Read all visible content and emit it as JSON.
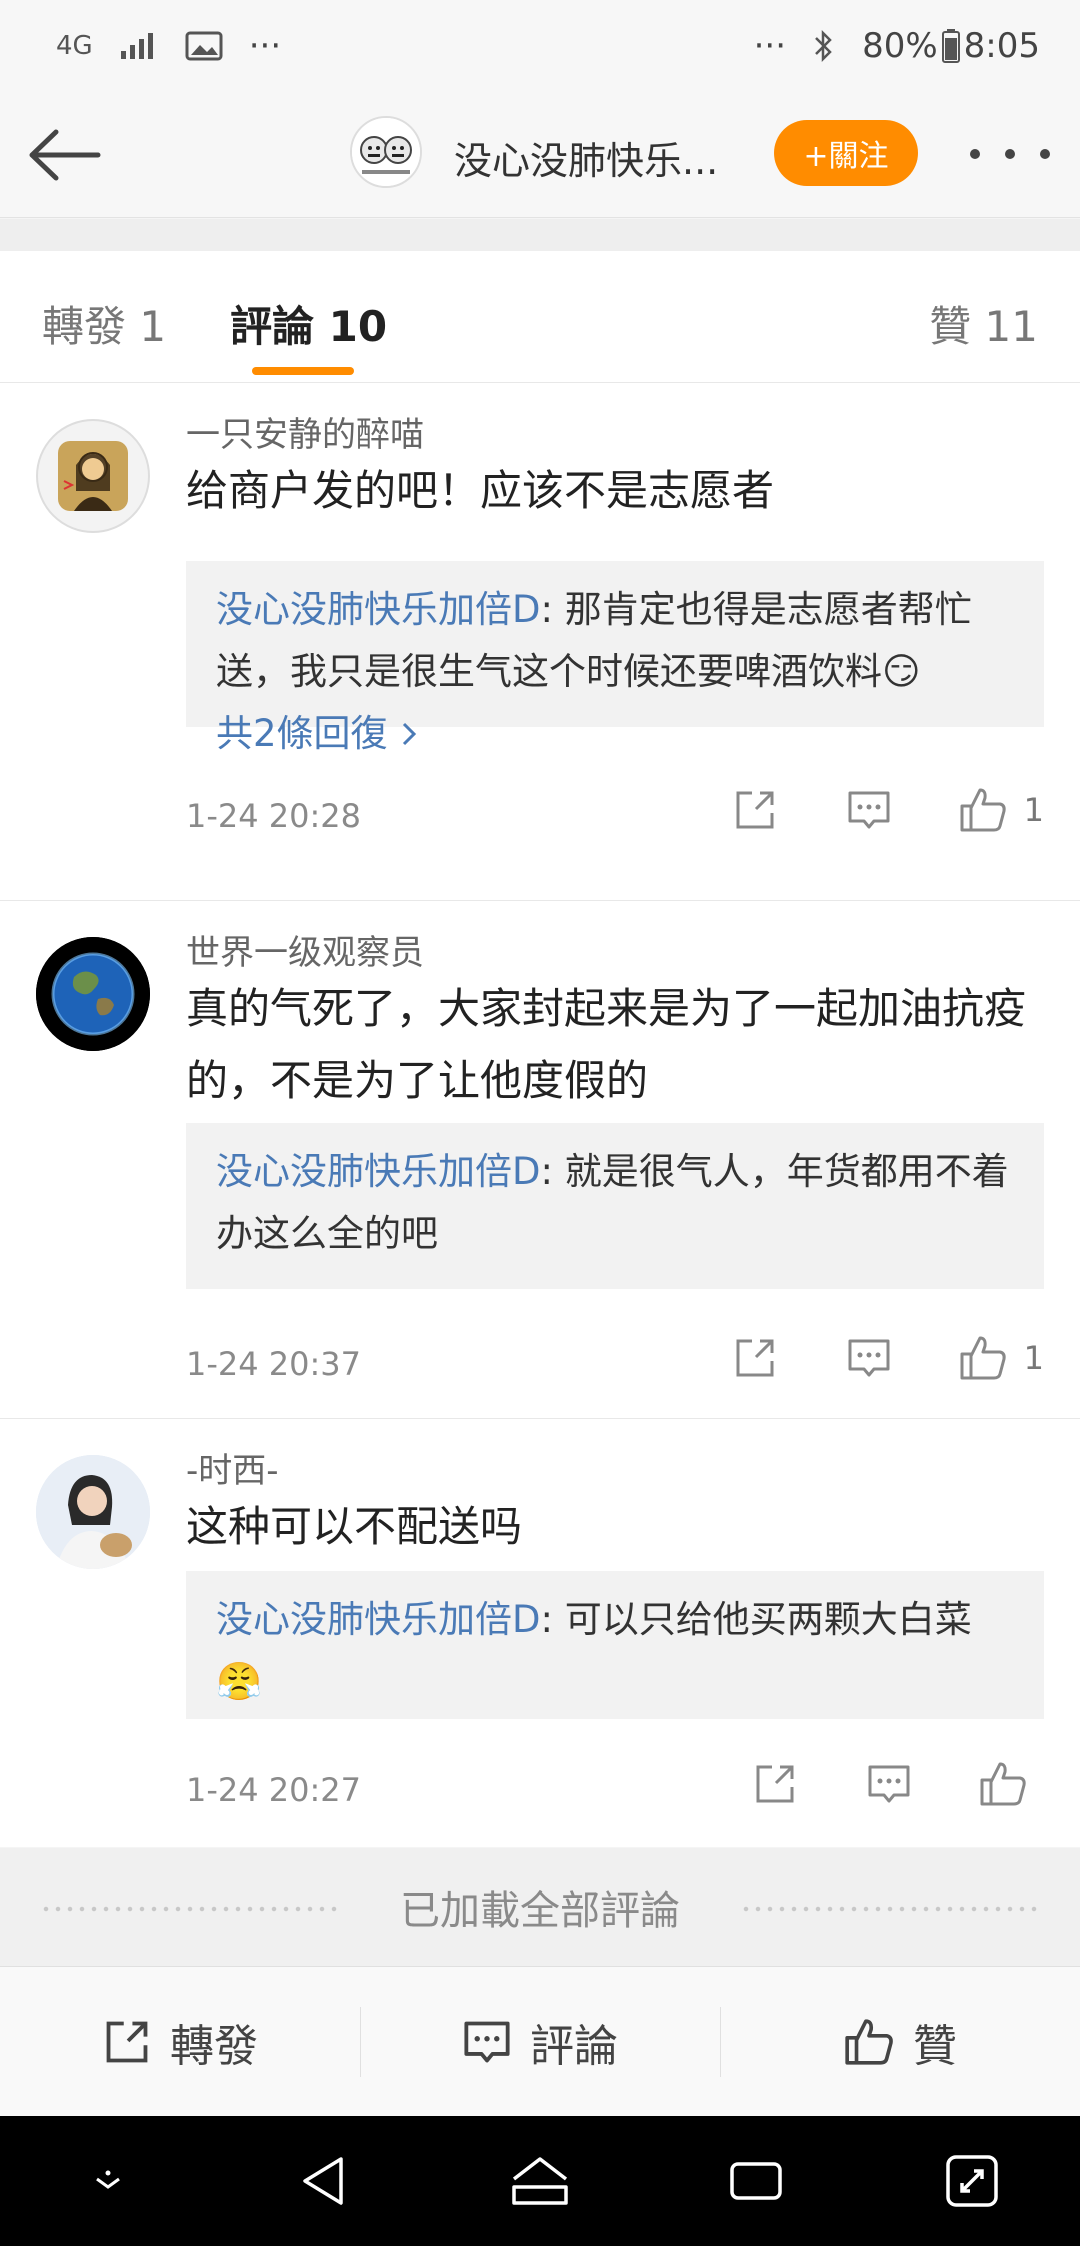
{
  "status_bar": {
    "network": "4G",
    "overflow": "···",
    "overflow_right": "···",
    "battery": "80%",
    "time": "8:05"
  },
  "header": {
    "title": "没心没肺快乐...",
    "follow_label": "+關注"
  },
  "tabs": [
    {
      "label": "轉發 1"
    },
    {
      "label": "評論 10"
    },
    {
      "label": "贊 11"
    }
  ],
  "comments": [
    {
      "user": "一只安静的醉喵",
      "text": "给商户发的吧！应该不是志愿者",
      "reply": {
        "name": "没心没肺快乐加倍D",
        "text": ": 那肯定也得是志愿者帮忙送，我只是很生气这个时候还要啤酒饮料😏",
        "more": "共2條回復"
      },
      "time": "1-24 20:28",
      "likes": "1"
    },
    {
      "user": "世界一级观察员",
      "text": "真的气死了，大家封起来是为了一起加油抗疫的，不是为了让他度假的",
      "reply": {
        "name": "没心没肺快乐加倍D",
        "text": ": 就是很气人，年货都用不着办这么全的吧"
      },
      "time": "1-24 20:37",
      "likes": "1"
    },
    {
      "user": "-时西-",
      "text": "这种可以不配送吗",
      "reply": {
        "name": "没心没肺快乐加倍D",
        "text": ": 可以只给他买两颗大白菜😤"
      },
      "time": "1-24 20:27",
      "likes": ""
    }
  ],
  "footer_text": "已加載全部評論",
  "bottom_bar": {
    "repost": "轉發",
    "comment": "評論",
    "like": "贊"
  },
  "colors": {
    "accent": "#ff8c00",
    "link": "#4a7ab6"
  }
}
